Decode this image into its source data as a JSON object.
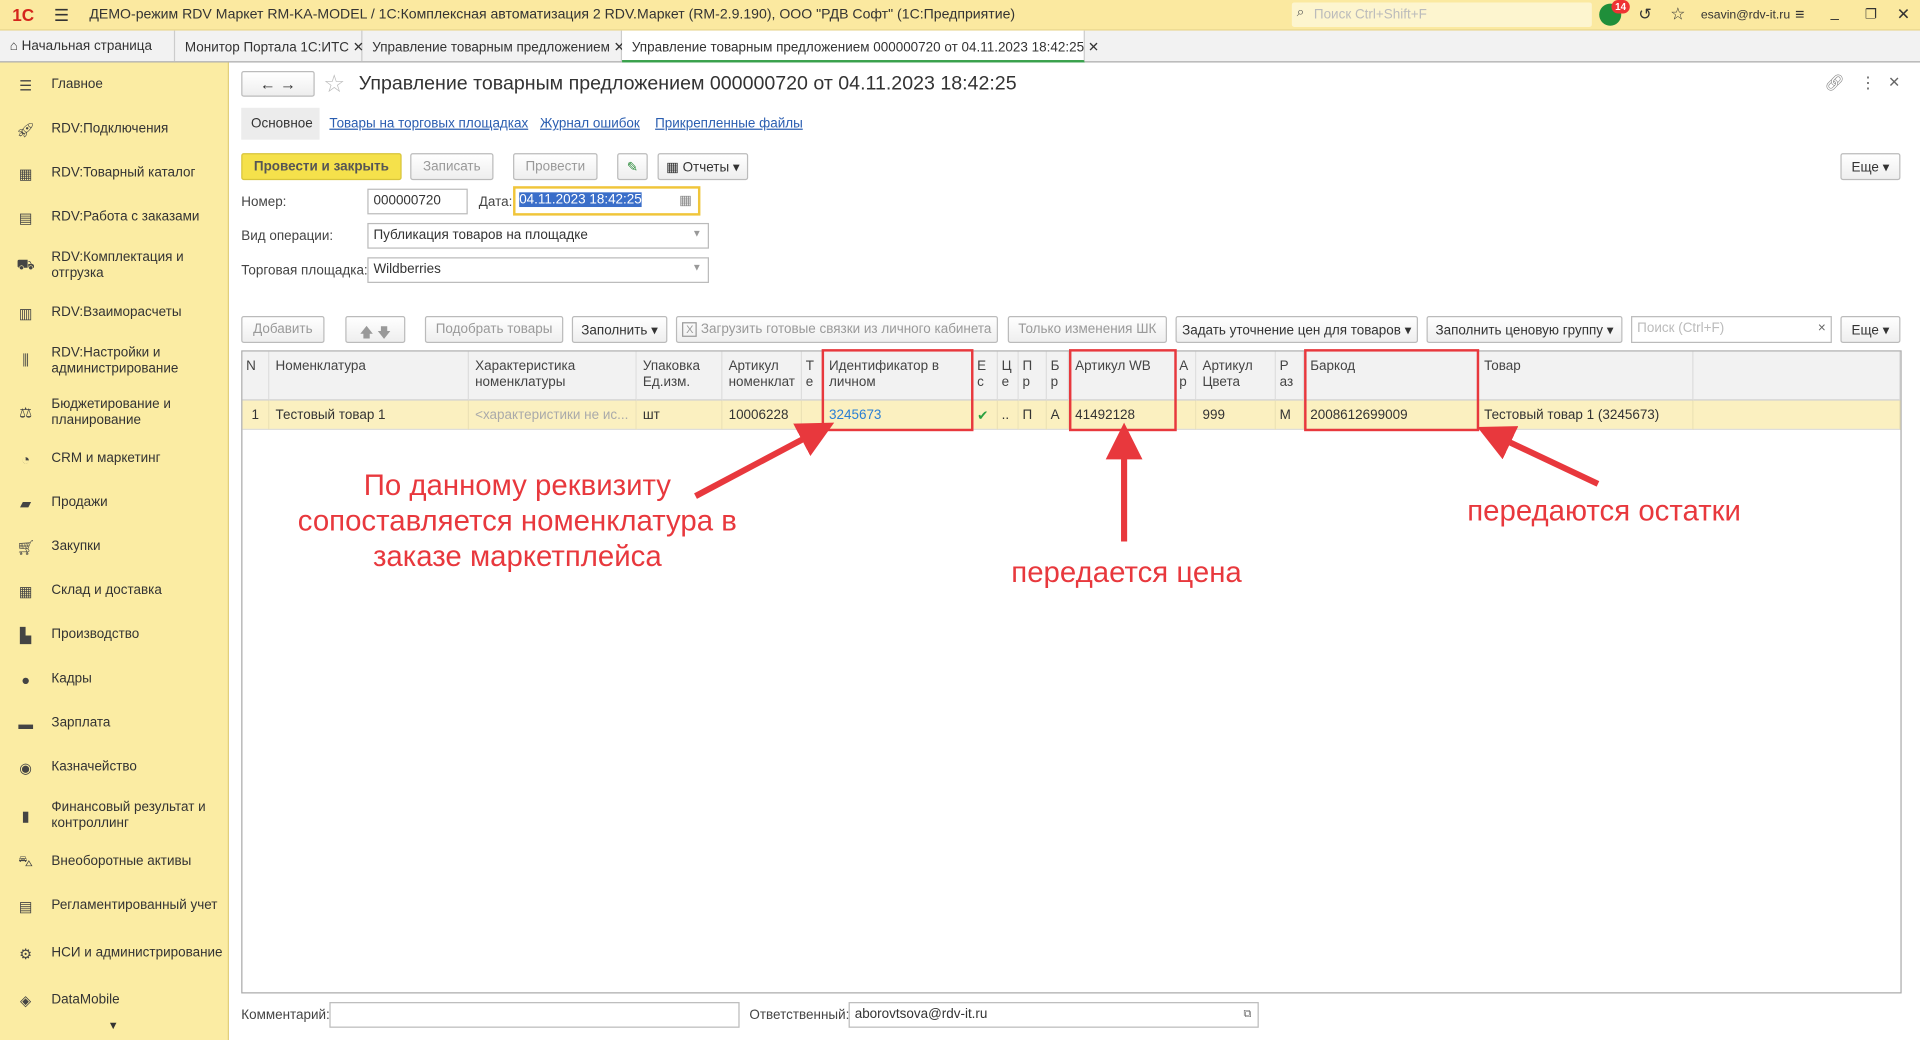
{
  "app": {
    "title": "ДЕМО-режим RDV Маркет RM-KA-MODEL / 1С:Комплексная автоматизация 2 RDV.Маркет (RM-2.9.190), ООО \"РДВ Софт\"  (1С:Предприятие)",
    "search_placeholder": "Поиск Ctrl+Shift+F",
    "notifications": "14",
    "user": "esavin@rdv-it.ru"
  },
  "tabs": [
    {
      "label": "Начальная страница"
    },
    {
      "label": "Монитор Портала 1С:ИТС"
    },
    {
      "label": "Управление товарным предложением"
    },
    {
      "label": "Управление товарным предложением 000000720 от 04.11.2023 18:42:25"
    }
  ],
  "sidebar": [
    {
      "label": "Главное",
      "icon": "menu"
    },
    {
      "label": "RDV:Подключения",
      "icon": "rocket"
    },
    {
      "label": "RDV:Товарный каталог",
      "icon": "grid"
    },
    {
      "label": "RDV:Работа с заказами",
      "icon": "doc"
    },
    {
      "label": "RDV:Комплектация и отгрузка",
      "icon": "box"
    },
    {
      "label": "RDV:Взаиморасчеты",
      "icon": "calc"
    },
    {
      "label": "RDV:Настройки и администрирование",
      "icon": "sliders"
    },
    {
      "label": "Бюджетирование и планирование",
      "icon": "budget"
    },
    {
      "label": "CRM и маркетинг",
      "icon": "pie"
    },
    {
      "label": "Продажи",
      "icon": "bag"
    },
    {
      "label": "Закупки",
      "icon": "cart"
    },
    {
      "label": "Склад и доставка",
      "icon": "warehouse"
    },
    {
      "label": "Производство",
      "icon": "factory"
    },
    {
      "label": "Кадры",
      "icon": "person"
    },
    {
      "label": "Зарплата",
      "icon": "wallet"
    },
    {
      "label": "Казначейство",
      "icon": "coin"
    },
    {
      "label": "Финансовый результат и контроллинг",
      "icon": "chart"
    },
    {
      "label": "Внеоборотные активы",
      "icon": "car"
    },
    {
      "label": "Регламентированный учет",
      "icon": "calc2"
    },
    {
      "label": "НСИ и администрирование",
      "icon": "gear"
    },
    {
      "label": "DataMobile",
      "icon": "dm"
    }
  ],
  "doc": {
    "title": "Управление товарным предложением 000000720 от 04.11.2023 18:42:25",
    "subtabs": [
      "Основное",
      "Товары на торговых площадках",
      "Журнал ошибок",
      "Прикрепленные файлы"
    ],
    "buttons": {
      "post_close": "Провести и закрыть",
      "save": "Записать",
      "post": "Провести",
      "reports": "Отчеты",
      "more": "Еще"
    },
    "number_label": "Номер:",
    "number": "000000720",
    "date_label": "Дата:",
    "date": "04.11.2023 18:42:25",
    "op_label": "Вид операции:",
    "op": "Публикация товаров на площадке",
    "mp_label": "Торговая площадка:",
    "mp": "Wildberries",
    "toolbar": {
      "add": "Добавить",
      "pick": "Подобрать товары",
      "fill": "Заполнить",
      "load": "Загрузить готовые связки из личного кабинета",
      "barcode_only": "Только изменения ШК",
      "prices": "Задать уточнение цен для товаров",
      "price_group": "Заполнить ценовую группу",
      "search_placeholder": "Поиск (Ctrl+F)",
      "more": "Еще"
    },
    "columns": [
      "N",
      "Номенклатура",
      "Характеристика номенклатуры",
      "Упаковка Ед.изм.",
      "Артикул номенклат",
      "Т е",
      "Идентификатор в личном",
      "Е с",
      "Ц е",
      "П р",
      "Б р",
      "Артикул WB",
      "А р",
      "Артикул Цвета",
      "Р аз",
      "Баркод",
      "Товар",
      ""
    ],
    "row": [
      "1",
      "Тестовый товар 1",
      "<характеристики не ис...",
      "шт",
      "10006228",
      "",
      "3245673",
      "✔",
      "..",
      "П",
      "А",
      "41492128",
      "",
      "999",
      "М",
      "2008612699009",
      "Тестовый товар 1 (3245673)",
      ""
    ],
    "comment_label": "Комментарий:",
    "comment": "",
    "resp_label": "Ответственный:",
    "resp": "aborovtsova@rdv-it.ru"
  },
  "annotations": {
    "left": "По данному реквизиту сопоставляется номенклатура в заказе маркетплейса",
    "middle": "передается цена",
    "right": "передаются остатки"
  },
  "colors": {
    "accent": "#e8383d",
    "topbar": "#fbe9a0",
    "sidebar": "#fbeca3",
    "row": "#fbf0c0"
  }
}
